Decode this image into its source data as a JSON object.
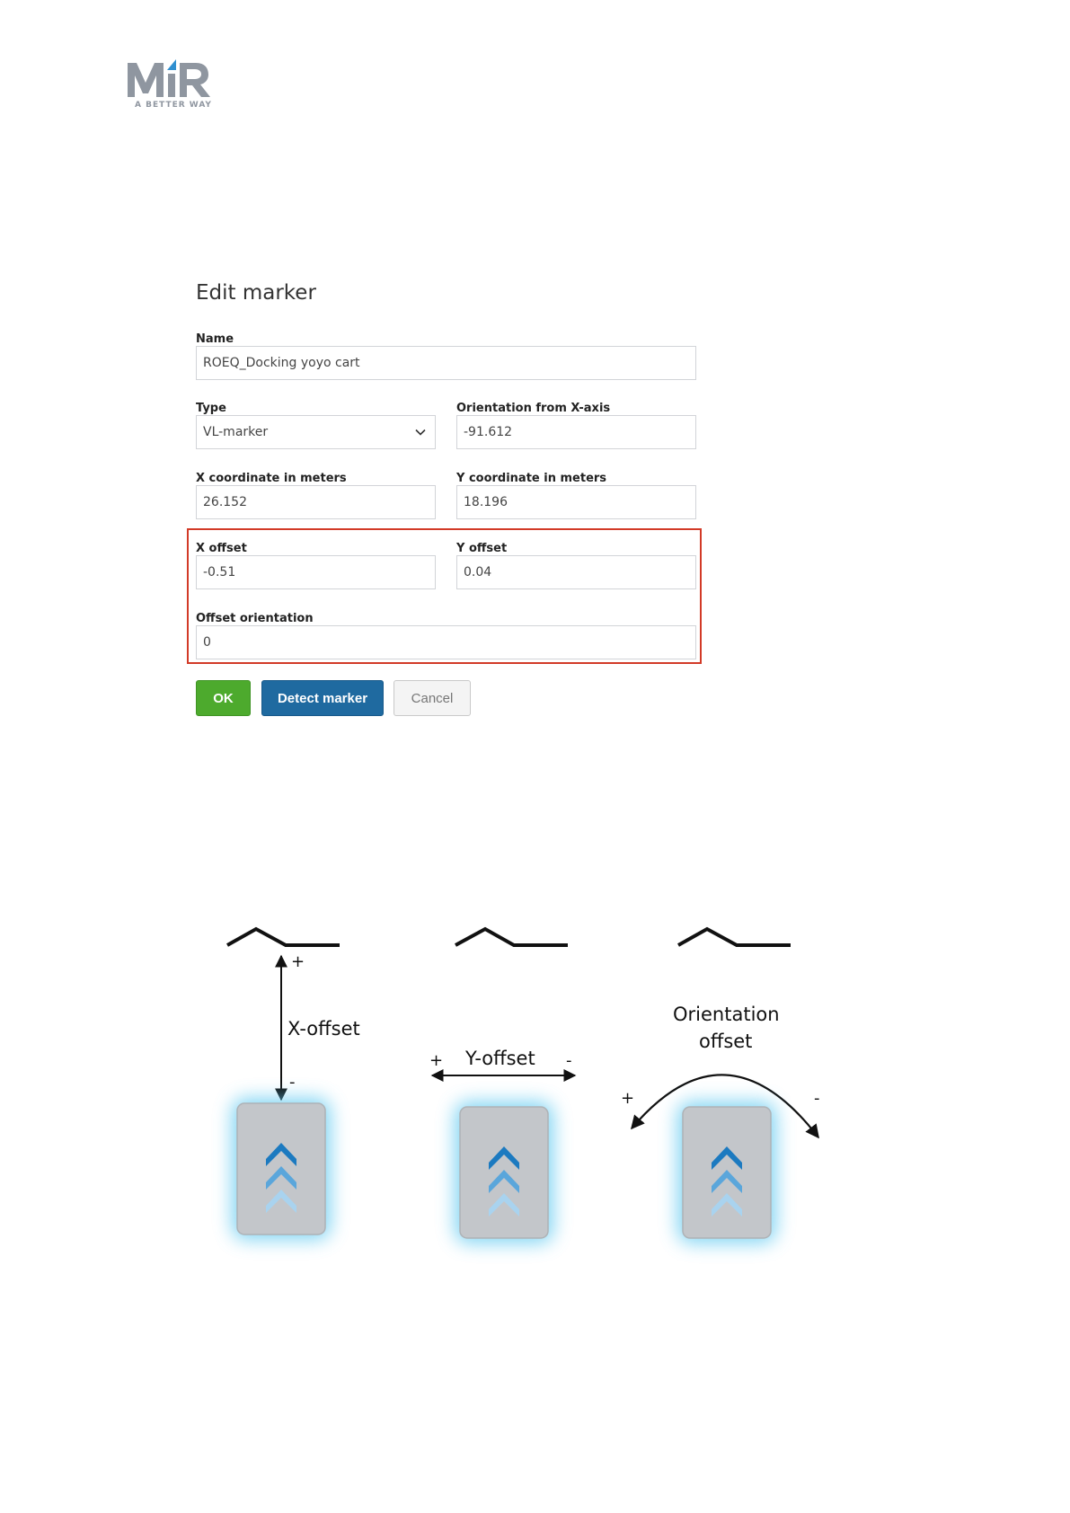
{
  "logo": {
    "text": "MiR",
    "tagline": "A BETTER WAY"
  },
  "dialog": {
    "title": "Edit marker",
    "name": {
      "label": "Name",
      "value": "ROEQ_Docking yoyo cart"
    },
    "type": {
      "label": "Type",
      "value": "VL-marker"
    },
    "orientation": {
      "label": "Orientation from X-axis",
      "value": "-91.612"
    },
    "x_coord": {
      "label": "X coordinate in meters",
      "value": "26.152"
    },
    "y_coord": {
      "label": "Y coordinate in meters",
      "value": "18.196"
    },
    "x_offset": {
      "label": "X offset",
      "value": "-0.51"
    },
    "y_offset": {
      "label": "Y offset",
      "value": "0.04"
    },
    "offset_orientation": {
      "label": "Offset orientation",
      "value": "0"
    },
    "buttons": {
      "ok": "OK",
      "detect": "Detect marker",
      "cancel": "Cancel"
    },
    "highlight_color": "#d23a27"
  },
  "diagram": {
    "x_offset": {
      "label": "X-offset",
      "plus": "+",
      "minus": "-"
    },
    "y_offset": {
      "label": "Y-offset",
      "plus": "+",
      "minus": "-"
    },
    "orientation": {
      "label_line1": "Orientation",
      "label_line2": "offset",
      "plus": "+",
      "minus": "-"
    },
    "colors": {
      "robot_body": "#c3c6ca",
      "glow": "#5cc8f0",
      "chevron_dark": "#1c7ac0",
      "chevron_mid": "#5aa6db",
      "chevron_light": "#a9d3ef"
    }
  }
}
